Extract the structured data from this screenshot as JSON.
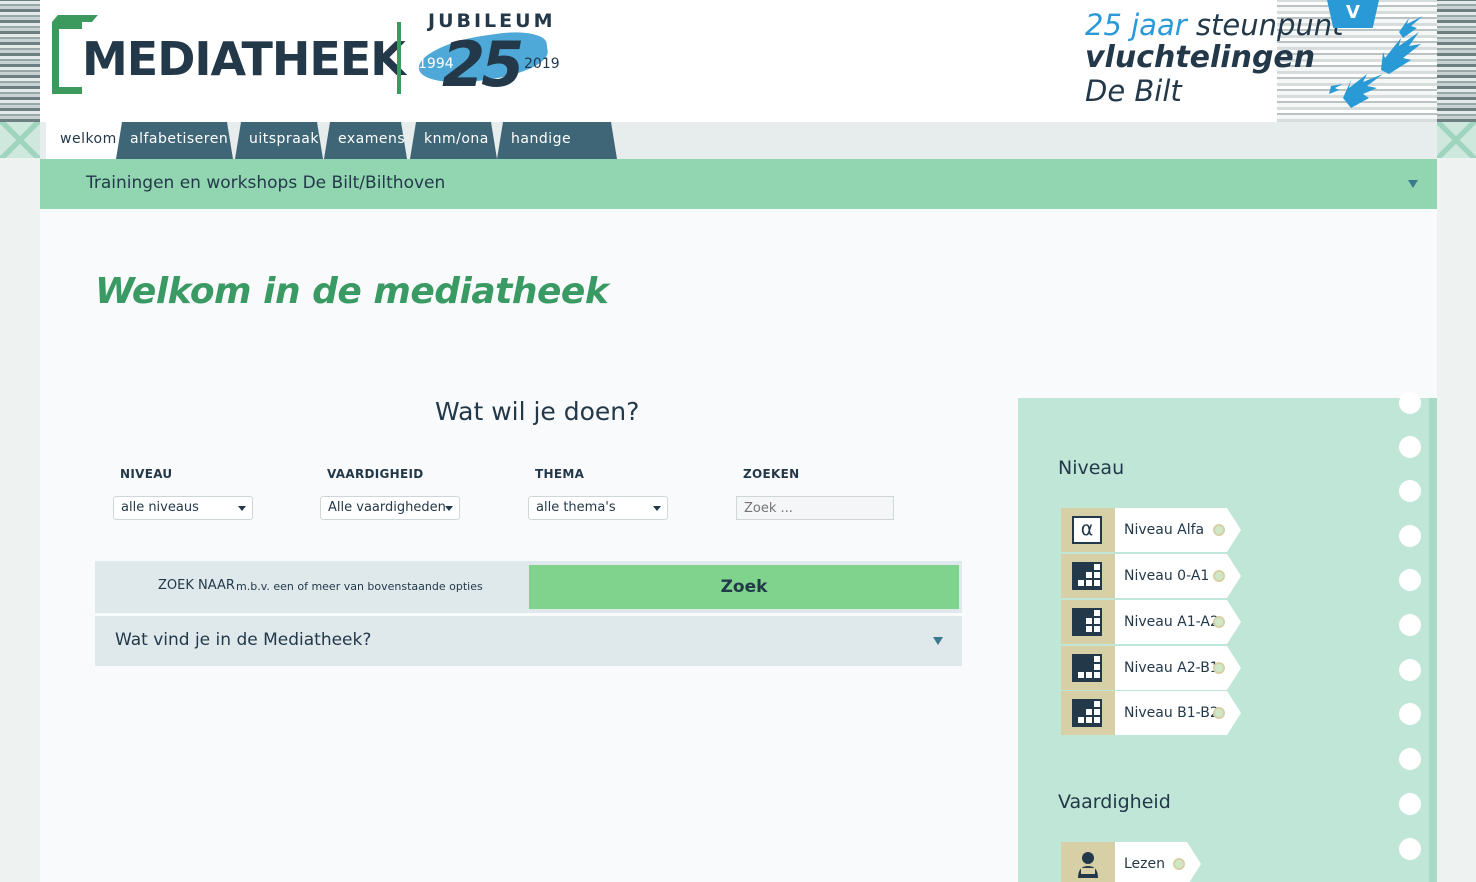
{
  "header": {
    "logo_text": "MEDIATHEEK",
    "jubileum": {
      "title": "JUBILEUM",
      "number": "25",
      "year_start": "1994",
      "year_end": "2019"
    },
    "steunpunt": {
      "line1_prefix": "25 jaar",
      "line1_suffix": "steunpunt",
      "line2": "vluchtelingen",
      "line3": "De Bilt",
      "badge": "V"
    }
  },
  "tabs": [
    {
      "label": "welkom",
      "active": true
    },
    {
      "label": "alfabetiseren",
      "active": false
    },
    {
      "label": "uitspraak",
      "active": false
    },
    {
      "label": "examens",
      "active": false
    },
    {
      "label": "knm/ona",
      "active": false
    },
    {
      "label": "handige sites",
      "active": false
    }
  ],
  "subbar": {
    "label": "Trainingen en workshops De Bilt/Bilthoven"
  },
  "main": {
    "title": "Welkom in de mediatheek",
    "search": {
      "heading": "Wat wil je doen?",
      "filters": {
        "niveau": {
          "label": "NIVEAU",
          "value": "alle niveaus"
        },
        "vaardigheid": {
          "label": "VAARDIGHEID",
          "value": "Alle vaardigheden"
        },
        "thema": {
          "label": "THEMA",
          "value": "alle thema's"
        },
        "zoeken": {
          "label": "ZOEKEN",
          "placeholder": "Zoek ..."
        }
      },
      "zoek_naar_label": "ZOEK NAAR",
      "zoek_naar_hint": "m.b.v. een of meer van bovenstaande opties",
      "zoek_button": "Zoek",
      "info_label": "Wat vind je in de Mediatheek?"
    }
  },
  "sidebar": {
    "niveau_heading": "Niveau",
    "levels": [
      {
        "label": "Niveau Alfa",
        "icon": "alpha-icon"
      },
      {
        "label": "Niveau 0-A1",
        "icon": "level-grid-icon"
      },
      {
        "label": "Niveau A1-A2",
        "icon": "level-grid-icon"
      },
      {
        "label": "Niveau A2-B1",
        "icon": "level-grid-icon"
      },
      {
        "label": "Niveau B1-B2",
        "icon": "level-grid-icon"
      }
    ],
    "vaardigheid_heading": "Vaardigheid",
    "skills": [
      {
        "label": "Lezen",
        "icon": "reader-icon"
      }
    ]
  },
  "colors": {
    "accent_green": "#3a9a63",
    "subbar_green": "#92d6b1",
    "button_green": "#7fd38d",
    "tab_blue": "#3f6677",
    "text_dark": "#23394a",
    "panel_mint": "#bfe6d7",
    "steunpunt_blue": "#2a9ad6"
  }
}
